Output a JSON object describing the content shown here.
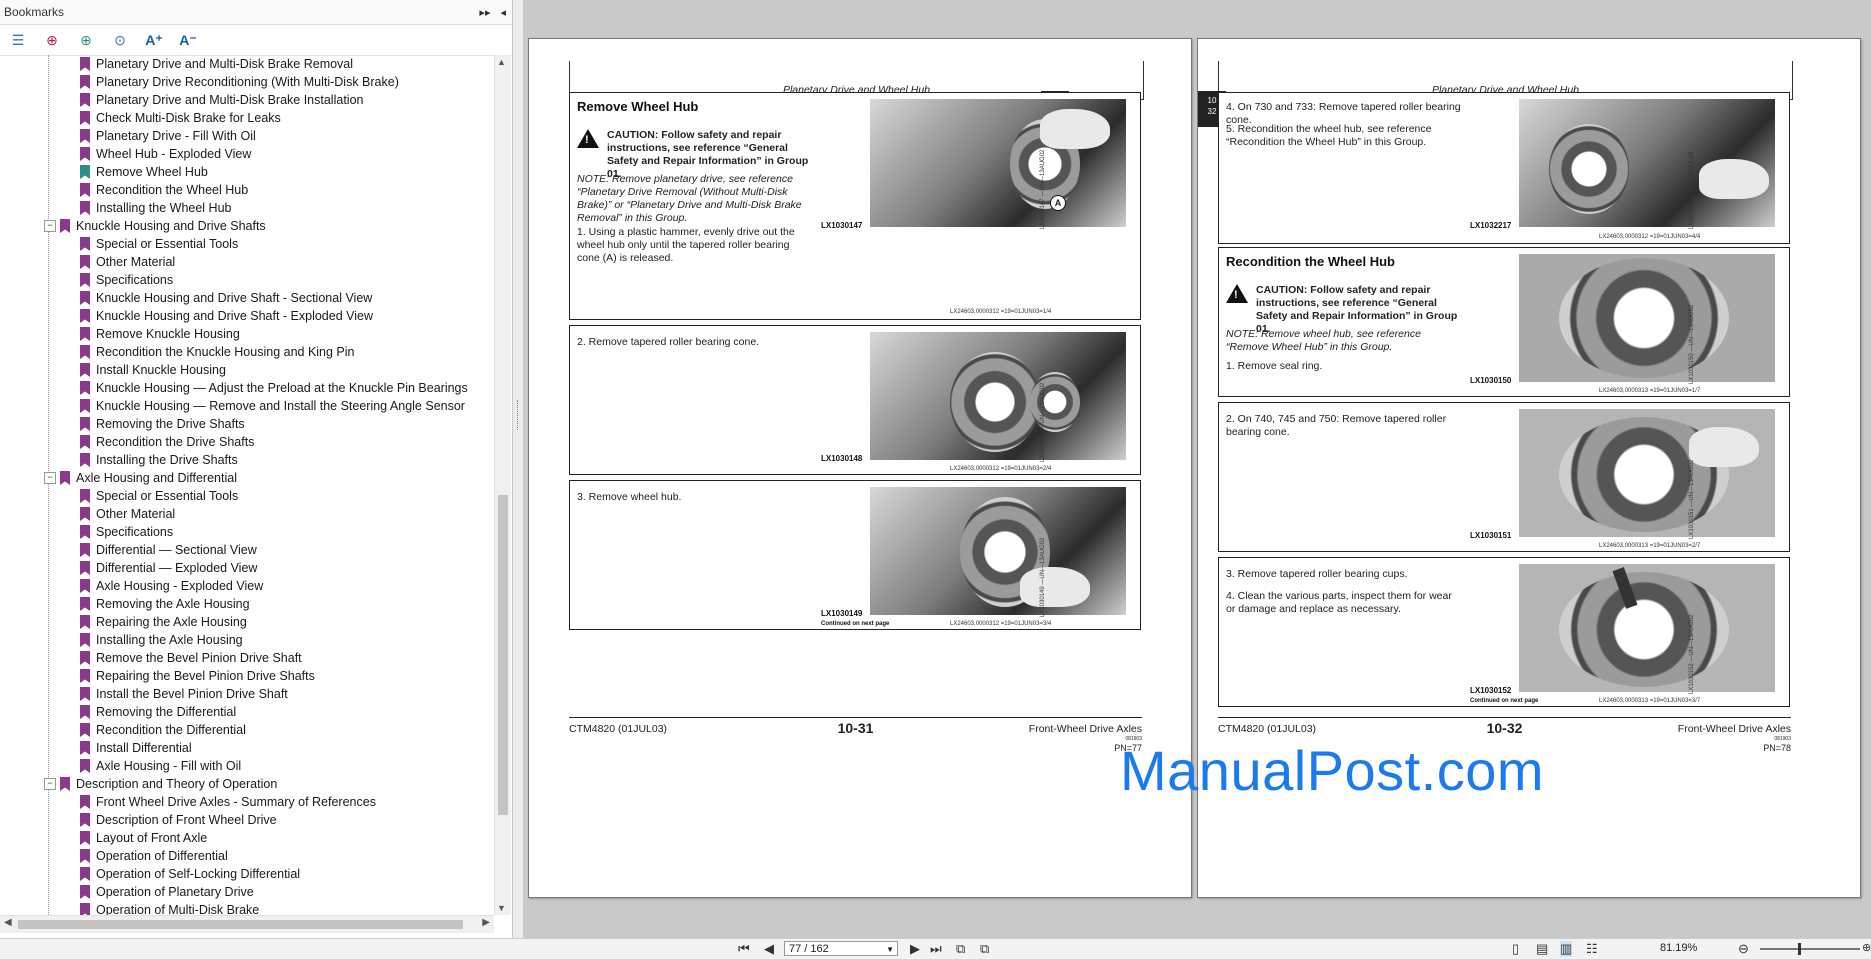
{
  "bookmarks_panel": {
    "title": "Bookmarks",
    "items": [
      {
        "label": "Planetary Drive and Multi-Disk Brake Removal",
        "level": 2
      },
      {
        "label": "Planetary Drive Reconditioning (With Multi-Disk Brake)",
        "level": 2
      },
      {
        "label": "Planetary Drive and Multi-Disk Brake Installation",
        "level": 2
      },
      {
        "label": "Check Multi-Disk Brake for Leaks",
        "level": 2
      },
      {
        "label": "Planetary Drive - Fill With Oil",
        "level": 2
      },
      {
        "label": "Wheel Hub - Exploded View",
        "level": 2
      },
      {
        "label": "Remove Wheel Hub",
        "level": 2,
        "selected": true
      },
      {
        "label": "Recondition the Wheel Hub",
        "level": 2
      },
      {
        "label": "Installing the Wheel Hub",
        "level": 2
      },
      {
        "label": "Knuckle Housing and Drive Shafts",
        "level": 1
      },
      {
        "label": "Special or Essential Tools",
        "level": 2
      },
      {
        "label": "Other Material",
        "level": 2
      },
      {
        "label": "Specifications",
        "level": 2
      },
      {
        "label": "Knuckle Housing and Drive Shaft - Sectional View",
        "level": 2
      },
      {
        "label": "Knuckle Housing and Drive Shaft - Exploded View",
        "level": 2
      },
      {
        "label": "Remove Knuckle Housing",
        "level": 2
      },
      {
        "label": "Recondition the Knuckle Housing and King Pin",
        "level": 2
      },
      {
        "label": "Install Knuckle Housing",
        "level": 2
      },
      {
        "label": "Knuckle Housing — Adjust the Preload at the Knuckle Pin Bearings",
        "level": 2
      },
      {
        "label": "Knuckle Housing — Remove and Install the Steering Angle Sensor",
        "level": 2
      },
      {
        "label": "Removing the Drive Shafts",
        "level": 2
      },
      {
        "label": "Recondition the Drive Shafts",
        "level": 2
      },
      {
        "label": "Installing the Drive Shafts",
        "level": 2
      },
      {
        "label": "Axle Housing and Differential",
        "level": 1
      },
      {
        "label": "Special or Essential Tools",
        "level": 2
      },
      {
        "label": "Other Material",
        "level": 2
      },
      {
        "label": "Specifications",
        "level": 2
      },
      {
        "label": "Differential — Sectional View",
        "level": 2
      },
      {
        "label": "Differential — Exploded View",
        "level": 2
      },
      {
        "label": "Axle Housing - Exploded View",
        "level": 2
      },
      {
        "label": "Removing the Axle Housing",
        "level": 2
      },
      {
        "label": "Repairing the Axle Housing",
        "level": 2
      },
      {
        "label": "Installing the Axle Housing",
        "level": 2
      },
      {
        "label": "Remove the Bevel Pinion Drive Shaft",
        "level": 2
      },
      {
        "label": "Repairing the Bevel Pinion Drive Shafts",
        "level": 2
      },
      {
        "label": "Install the Bevel Pinion Drive Shaft",
        "level": 2
      },
      {
        "label": "Removing the Differential",
        "level": 2
      },
      {
        "label": "Recondition the Differential",
        "level": 2
      },
      {
        "label": "Install Differential",
        "level": 2
      },
      {
        "label": "Axle Housing - Fill with Oil",
        "level": 2
      },
      {
        "label": "Description and Theory of Operation",
        "level": 1
      },
      {
        "label": "Front Wheel Drive Axles - Summary of References",
        "level": 2
      },
      {
        "label": "Description of Front Wheel Drive",
        "level": 2
      },
      {
        "label": "Layout of Front Axle",
        "level": 2
      },
      {
        "label": "Operation of Differential",
        "level": 2
      },
      {
        "label": "Operation of Self-Locking Differential",
        "level": 2
      },
      {
        "label": "Operation of Planetary Drive",
        "level": 2
      },
      {
        "label": "Operation of Multi-Disk Brake",
        "level": 2
      }
    ]
  },
  "left_page": {
    "header": "Planetary Drive and Wheel Hub",
    "tab": [
      "10",
      "31"
    ],
    "section_title": "Remove Wheel Hub",
    "caution": "CAUTION: Follow safety and repair instructions, see reference “General Safety and Repair Information” in Group 01.",
    "note": "NOTE: Remove planetary drive, see reference “Planetary Drive Removal (Without Multi-Disk Brake)” or “Planetary Drive and Multi-Disk Brake Removal” in this Group.",
    "steps": [
      {
        "text": "1.  Using a plastic hammer, evenly drive out the wheel hub only until the tapered roller bearing cone (A) is released.",
        "photo_label": "LX1030147",
        "photo_side": "LX1030147 —UN—13AUG02",
        "code": "LX24603,0000312  =19=01JUN03=1/4",
        "callout": "A"
      },
      {
        "text": "2.  Remove tapered roller bearing cone.",
        "photo_label": "LX1030148",
        "photo_side": "LX1030148 —UN—13AUG02",
        "code": "LX24603,0000312  =19=01JUN03=2/4"
      },
      {
        "text": "3.  Remove wheel hub.",
        "photo_label": "LX1030149",
        "photo_side": "LX1030149 —UN—13AUG02",
        "code": "LX24603,0000312  =19=01JUN03=3/4",
        "continued": "Continued on next page"
      }
    ],
    "footer": {
      "left": "CTM4820 (01JUL03)",
      "center": "10-31",
      "right": "Front-Wheel Drive Axles",
      "right2": "081903",
      "pn": "PN=77"
    }
  },
  "right_page": {
    "header": "Planetary Drive and Wheel Hub",
    "tab": [
      "10",
      "32"
    ],
    "top_steps": [
      "4.  On 730 and 733: Remove tapered roller bearing cone.",
      "5.  Recondition the wheel hub, see reference “Recondition the Wheel Hub” in this Group."
    ],
    "top_photo_label": "LX1032217",
    "top_photo_side": "LX1032217 —UN—03JUL03",
    "top_code": "LX24603,0000312  =19=01JUN03=4/4",
    "section_title": "Recondition the Wheel Hub",
    "caution": "CAUTION: Follow safety and repair instructions, see reference “General Safety and Repair Information” in Group 01.",
    "note": "NOTE: Remove wheel hub, see reference “Remove Wheel Hub” in this Group.",
    "step1": "1.  Remove seal ring.",
    "photo1_label": "LX1030150",
    "photo1_side": "LX1030150 —UN—13AUG02",
    "code1": "LX24603,0000313  =19=01JUN03=1/7",
    "step2": "2.  On 740, 745 and 750: Remove tapered roller bearing cone.",
    "photo2_label": "LX1030151",
    "photo2_side": "LX1030151 —UN—13AUG02",
    "code2": "LX24603,0000313  =19=01JUN03=2/7",
    "step3": "3.  Remove tapered roller bearing cups.",
    "step4": "4.  Clean the various parts, inspect them for wear or damage and replace as necessary.",
    "photo3_label": "LX1030152",
    "photo3_side": "LX1030152 —UN—13AUG02",
    "code3": "LX24603,0000313  =19=01JUN03=3/7",
    "continued": "Continued on next page",
    "footer": {
      "left": "CTM4820 (01JUL03)",
      "center": "10-32",
      "right": "Front-Wheel Drive Axles",
      "right2": "081903",
      "pn": "PN=78"
    }
  },
  "watermark": "ManualPost.com",
  "statusbar": {
    "page_field": "77 / 162",
    "zoom": "81.19%"
  }
}
